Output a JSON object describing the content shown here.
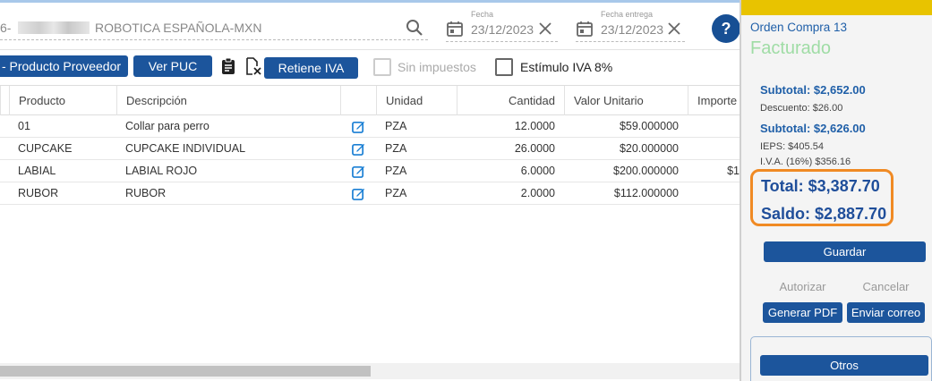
{
  "header": {
    "supplier_prefix": "6-",
    "supplier_name": "ROBOTICA ESPAÑOLA-MXN",
    "fecha_label": "Fecha",
    "fecha_value": "23/12/2023",
    "fecha_entrega_label": "Fecha entrega",
    "fecha_entrega_value": "23/12/2023",
    "help_label": "?"
  },
  "toolbar": {
    "producto_proveedor": "- Producto Proveedor",
    "ver_puc": "Ver PUC",
    "retiene_iva": "Retiene IVA",
    "sin_impuestos": "Sin impuestos",
    "estimulo_iva": "Estímulo IVA 8%"
  },
  "table": {
    "columns": [
      "Producto",
      "Descripción",
      "Unidad",
      "Cantidad",
      "Valor Unitario",
      "Importe"
    ],
    "rows": [
      {
        "producto": "01",
        "descripcion": "Collar para perro",
        "unidad": "PZA",
        "cantidad": "12.0000",
        "valor": "$59.000000",
        "importe": ""
      },
      {
        "producto": "CUPCAKE",
        "descripcion": "CUPCAKE INDIVIDUAL",
        "unidad": "PZA",
        "cantidad": "26.0000",
        "valor": "$20.000000",
        "importe": ""
      },
      {
        "producto": "LABIAL",
        "descripcion": "LABIAL ROJO",
        "unidad": "PZA",
        "cantidad": "6.0000",
        "valor": "$200.000000",
        "importe": "$1"
      },
      {
        "producto": "RUBOR",
        "descripcion": "RUBOR",
        "unidad": "PZA",
        "cantidad": "2.0000",
        "valor": "$112.000000",
        "importe": ""
      }
    ]
  },
  "panel": {
    "order_title": "Orden Compra 13",
    "status": "Facturado",
    "subtotal1": "Subtotal: $2,652.00",
    "descuento": "Descuento: $26.00",
    "subtotal2": "Subtotal: $2,626.00",
    "ieps": "IEPS: $405.54",
    "iva": "I.V.A. (16%) $356.16",
    "total": "Total: $3,387.70",
    "saldo": "Saldo: $2,887.70",
    "guardar": "Guardar",
    "autorizar": "Autorizar",
    "cancelar": "Cancelar",
    "generar_pdf": "Generar PDF",
    "enviar_correo": "Enviar correo",
    "otros": "Otros"
  },
  "colors": {
    "primary": "#1c559c",
    "accent_bar": "#e8c300",
    "status_green": "#9fdca5",
    "highlight": "#f08a24"
  }
}
